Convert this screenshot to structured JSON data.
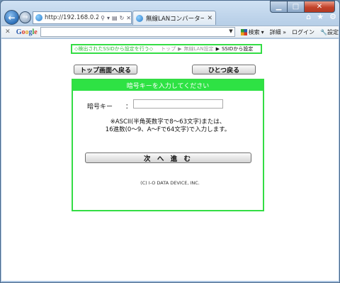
{
  "browser": {
    "address": "http://192.168.0.202",
    "tab_title": "無線LANコンバーター設...",
    "toolbar": {
      "search_label": "検索",
      "details_label": "詳細 »",
      "login_label": "ログイン",
      "settings_label": "設定"
    },
    "google_letters": [
      "G",
      "o",
      "o",
      "g",
      "l",
      "e"
    ]
  },
  "breadcrumb": {
    "lead": "◇検出されたSSIDから設定を行う◇",
    "steps": [
      "トップ",
      "無線LAN設定"
    ],
    "current": "SSIDから設定",
    "separator": "▶"
  },
  "buttons": {
    "top": "トップ画面へ戻る",
    "back": "ひとつ戻る",
    "next": "次 へ 進 む"
  },
  "panel": {
    "title": "暗号キーを入力してください",
    "key_label": "暗号キー",
    "colon": "：",
    "key_value": "",
    "note_line1": "※ASCII(半角英数字で8～63文字)または、",
    "note_line2": "16進数(0～9、A～Fで64文字)で入力します。"
  },
  "footer": "(C) I-O DATA DEVICE, INC."
}
